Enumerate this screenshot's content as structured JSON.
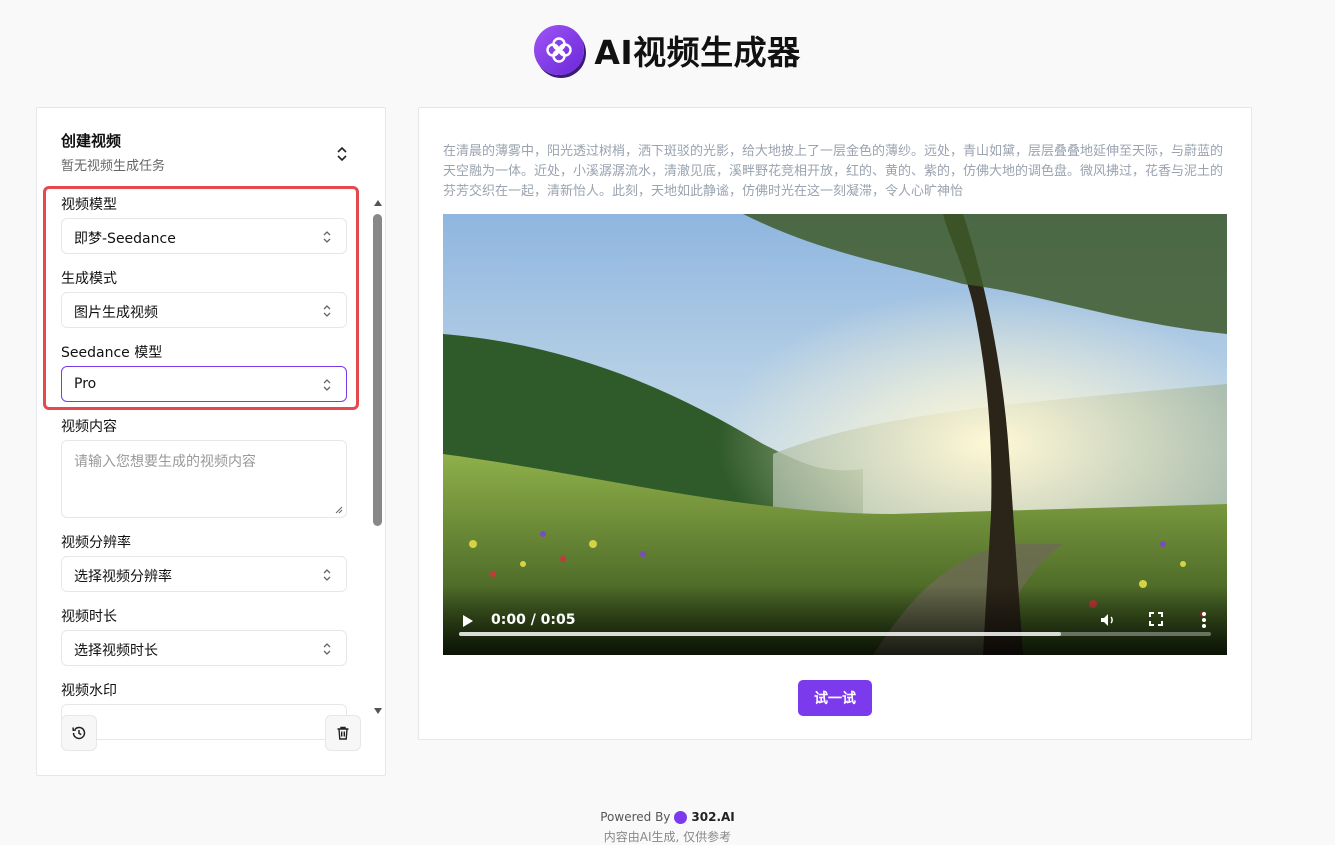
{
  "app": {
    "title": "AI视频生成器"
  },
  "left_panel": {
    "title": "创建视频",
    "subtitle": "暂无视频生成任务",
    "fields": {
      "video_model": {
        "label": "视频模型",
        "value": "即梦-Seedance"
      },
      "generate_mode": {
        "label": "生成模式",
        "value": "图片生成视频"
      },
      "seedance_model": {
        "label": "Seedance 模型",
        "value": "Pro"
      },
      "video_content": {
        "label": "视频内容",
        "placeholder": "请输入您想要生成的视频内容"
      },
      "resolution": {
        "label": "视频分辨率",
        "value": "选择视频分辨率"
      },
      "duration": {
        "label": "视频时长",
        "value": "选择视频时长"
      },
      "watermark": {
        "label": "视频水印"
      }
    },
    "icons": {
      "history": "history-icon",
      "delete": "trash-icon"
    },
    "highlight_color": "#e5484d"
  },
  "right_panel": {
    "prompt": "在清晨的薄雾中，阳光透过树梢，洒下斑驳的光影，给大地披上了一层金色的薄纱。远处，青山如黛，层层叠叠地延伸至天际，与蔚蓝的天空融为一体。近处，小溪潺潺流水，清澈见底，溪畔野花竞相开放，红的、黄的、紫的，仿佛大地的调色盘。微风拂过，花香与泥土的芬芳交织在一起，清新怡人。此刻，天地如此静谧，仿佛时光在这一刻凝滞，令人心旷神怡",
    "video": {
      "time": "0:00 / 0:05",
      "progress": 0.8
    },
    "try_button": "试一试"
  },
  "footer": {
    "powered_by": "Powered By",
    "brand": "302.AI",
    "disclaimer": "内容由AI生成, 仅供参考"
  },
  "colors": {
    "accent": "#7c3aed",
    "highlight": "#e5484d"
  }
}
